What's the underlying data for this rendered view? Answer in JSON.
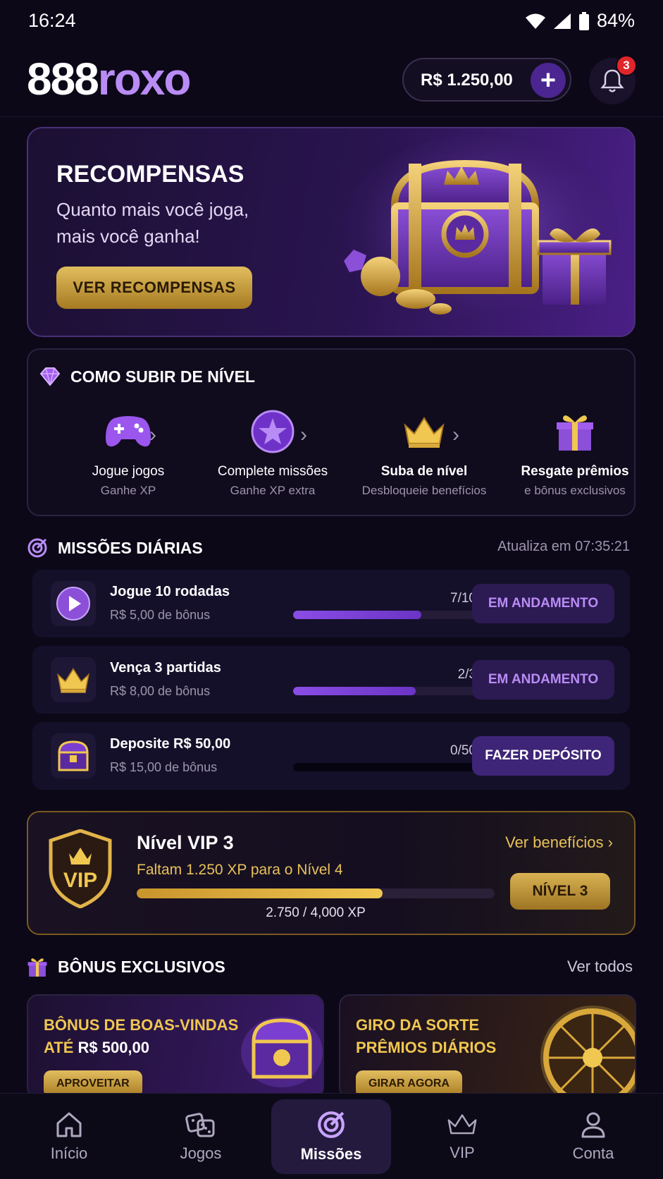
{
  "status": {
    "time": "16:24",
    "battery": "84%"
  },
  "header": {
    "logo_white": "888",
    "logo_purple": "roxo",
    "balance": "R$ 1.250,00",
    "notif_count": "3"
  },
  "hero": {
    "title": "RECOMPENSAS",
    "subtitle_1": "Quanto mais você joga,",
    "subtitle_2": "mais você ganha!",
    "button": "VER RECOMPENSAS"
  },
  "levels": {
    "title": "COMO SUBIR DE NÍVEL",
    "steps": [
      {
        "label": "Jogue jogos",
        "sub": "Ganhe XP",
        "icon": "gamepad-icon"
      },
      {
        "label": "Complete missões",
        "sub": "Ganhe XP extra",
        "icon": "star-icon"
      },
      {
        "label": "Suba de nível",
        "sub": "Desbloqueie benefícios",
        "icon": "crown-icon"
      },
      {
        "label": "Resgate prêmios",
        "sub": "e bônus exclusivos",
        "icon": "gift-icon"
      }
    ]
  },
  "missions": {
    "title": "MISSÕES DIÁRIAS",
    "refresh": "Atualiza em 07:35:21",
    "items": [
      {
        "title": "Jogue 10 rodadas",
        "reward": "R$ 5,00 de bônus",
        "count": "7/10",
        "progress": 0.7,
        "action": "EM ANDAMENTO",
        "icon": "play-icon"
      },
      {
        "title": "Vença 3 partidas",
        "reward": "R$ 8,00 de bônus",
        "count": "2/3",
        "progress": 0.67,
        "action": "EM ANDAMENTO",
        "icon": "crown-icon"
      },
      {
        "title": "Deposite R$ 50,00",
        "reward": "R$ 15,00 de bônus",
        "count": "0/50",
        "progress": 0,
        "action": "FAZER DEPÓSITO",
        "icon": "chest-icon"
      }
    ]
  },
  "vip": {
    "level": "Nível VIP 3",
    "need": "Faltam 1.250 XP para o Nível 4",
    "xp": "2.750 / 4,000 XP",
    "progress": 0.6875,
    "benefits": "Ver benefícios",
    "button": "NÍVEL 3",
    "badge_text": "VIP"
  },
  "bonus": {
    "title": "BÔNUS EXCLUSIVOS",
    "see_all": "Ver todos",
    "cards": [
      {
        "line1": "BÔNUS DE BOAS-VINDAS",
        "line2_pre": "ATÉ ",
        "line2_value": "R$ 500,00",
        "button": "APROVEITAR"
      },
      {
        "line1": "GIRO DA SORTE",
        "line2": "PRÊMIOS DIÁRIOS",
        "button": "GIRAR AGORA"
      }
    ]
  },
  "nav": {
    "items": [
      {
        "label": "Início"
      },
      {
        "label": "Jogos"
      },
      {
        "label": "Missões"
      },
      {
        "label": "VIP"
      },
      {
        "label": "Conta"
      }
    ]
  },
  "colors": {
    "accent": "#8a4de6",
    "gold": "#f0c750",
    "bg": "#0c0818"
  }
}
